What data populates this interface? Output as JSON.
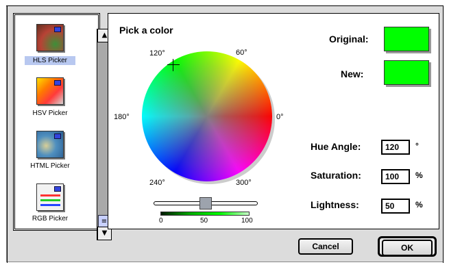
{
  "pickers": [
    {
      "label": "HLS Picker",
      "selected": true
    },
    {
      "label": "HSV Picker",
      "selected": false
    },
    {
      "label": "HTML Picker",
      "selected": false
    },
    {
      "label": "RGB Picker",
      "selected": false
    }
  ],
  "main": {
    "title": "Pick a color",
    "wheel_degrees": [
      "120°",
      "60°",
      "180°",
      "0°",
      "240°",
      "300°"
    ],
    "lightness_ticks": [
      "0",
      "50",
      "100"
    ],
    "original_label": "Original:",
    "new_label": "New:",
    "original_color": "#00ff00",
    "new_color": "#00ff00",
    "fields": {
      "hue_angle_label": "Hue Angle:",
      "hue_angle_value": "120",
      "hue_unit": "°",
      "saturation_label": "Saturation:",
      "saturation_value": "100",
      "saturation_unit": "%",
      "lightness_label": "Lightness:",
      "lightness_value": "50",
      "lightness_unit": "%"
    },
    "slider_value": 50
  },
  "buttons": {
    "cancel": "Cancel",
    "ok": "OK"
  },
  "icons": {
    "scroll_up": "▲",
    "scroll_down": "▼",
    "scroll_thumb": "≡"
  }
}
